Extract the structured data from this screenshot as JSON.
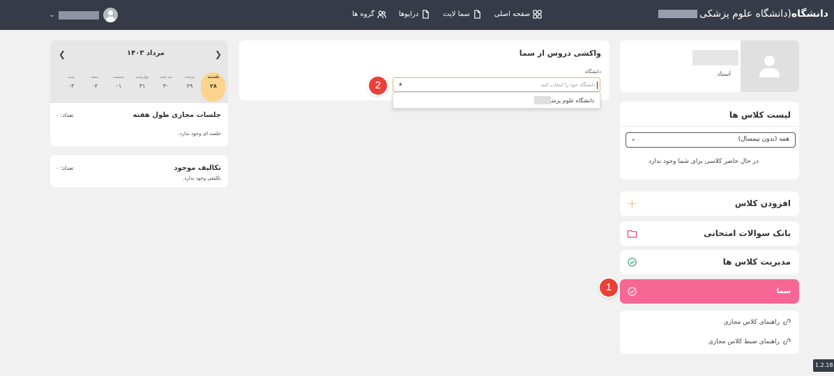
{
  "topbar": {
    "brand_bold": "دانشگاه",
    "brand_rest": "(دانشگاه علوم پزشکی",
    "nav": [
      {
        "label": "صفحه اصلی",
        "icon": "grid-icon"
      },
      {
        "label": "سما لایت",
        "icon": "file-icon"
      },
      {
        "label": "درایوها",
        "icon": "file-icon"
      },
      {
        "label": "گروه ها",
        "icon": "users-icon"
      }
    ]
  },
  "profile": {
    "role": "استاد"
  },
  "class_list": {
    "title": "لیست کلاس ها",
    "select_value": "همه (بدون نیمسال)",
    "empty_text": "در حال حاضر کلاسی برای شما وجود ندارد"
  },
  "menu": [
    {
      "label": "افزودن کلاس",
      "icon": "plus-icon",
      "color": "#f5c26b"
    },
    {
      "label": "بانک سوالات امتحانی",
      "icon": "folder-icon",
      "color": "#e9417a"
    },
    {
      "label": "مدیریت کلاس ها",
      "icon": "check-circle-icon",
      "color": "#2e9e6a"
    },
    {
      "label": "سما",
      "icon": "check-circle-icon",
      "color": "#ffffff"
    }
  ],
  "help": [
    {
      "label": "راهنمای کلاس مجازی",
      "icon": "link-icon"
    },
    {
      "label": "راهنمای ضبط کلاس مجازی",
      "icon": "link-icon"
    }
  ],
  "sama_fetch": {
    "title": "واکشی دروس از سما",
    "university_label": "دانشگاه",
    "placeholder": "دانشگاه خود را انتخاب کنید",
    "option": "دانشگاه علوم پزشکی"
  },
  "badges": {
    "one": "1",
    "two": "2"
  },
  "calendar": {
    "month": "مرداد ۱۴۰۳",
    "days": [
      {
        "name": "یکشنبه",
        "date": "۲۸",
        "active": true
      },
      {
        "name": "دوشنبه",
        "date": "۲۹"
      },
      {
        "name": "سه شنبه",
        "date": "۳۰"
      },
      {
        "name": "چهارشنبه",
        "date": "۳۱"
      },
      {
        "name": "پنجشنبه",
        "date": "۰۱"
      },
      {
        "name": "جمعه",
        "date": "۰۲"
      },
      {
        "name": "شنبه",
        "date": "۰۳"
      }
    ],
    "sessions_title": "جلسات مجازی طول هفته",
    "sessions_count": "تعداد: ۰",
    "sessions_empty": "جلسه ای وجود ندارد."
  },
  "tasks": {
    "title": "تکالیف موجود",
    "count": "تعداد: ۰",
    "empty": "تکلیفی وجود ندارد."
  },
  "version": "1.2.18"
}
